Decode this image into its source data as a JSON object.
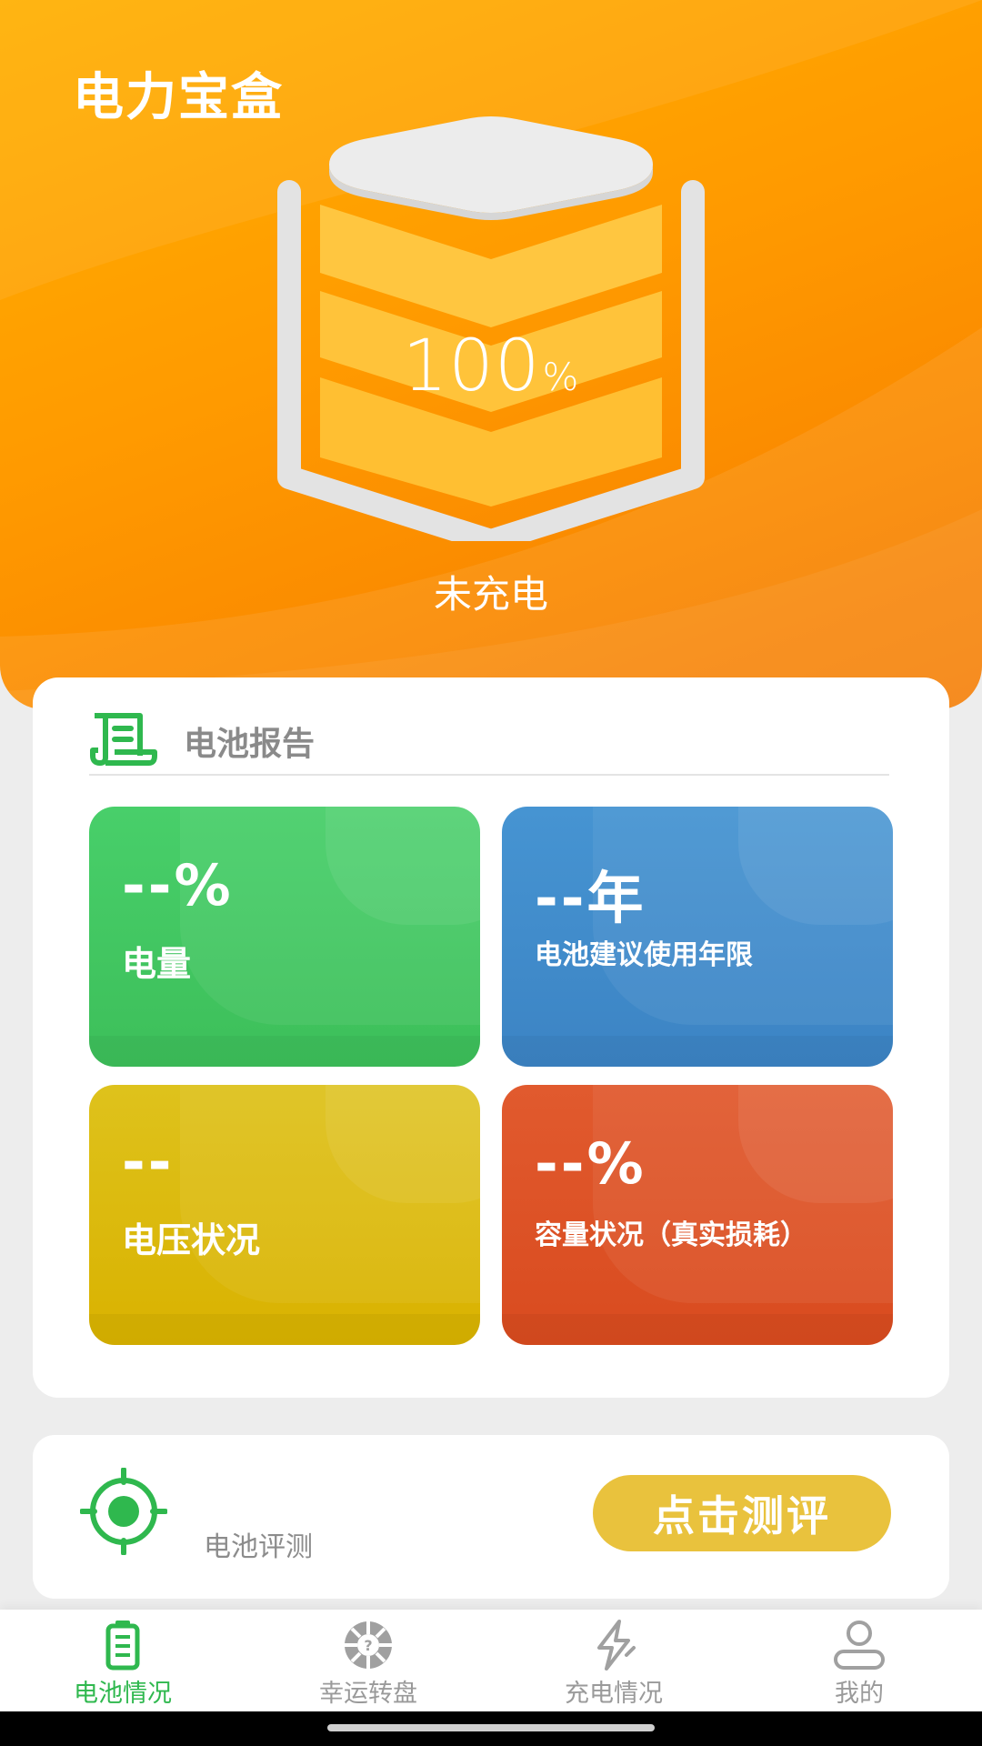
{
  "header": {
    "title": "电力宝盒",
    "battery_level": 100,
    "battery_value": "100",
    "battery_unit": "%",
    "charge_status": "未充电"
  },
  "report": {
    "title": "电池报告",
    "tiles": [
      {
        "value": "--%",
        "label": "电量",
        "color": "#44c964"
      },
      {
        "value": "--年",
        "label": "电池建议使用年限",
        "color": "#418dcc"
      },
      {
        "value": "--",
        "label": "电压状况",
        "color": "#dbb90f"
      },
      {
        "value": "--%",
        "label": "容量状况（真实损耗）",
        "color": "#dc5226"
      }
    ]
  },
  "evaluate": {
    "label": "电池评测",
    "button_label": "点击测评",
    "button_color": "#e9c23d"
  },
  "nav": {
    "items": [
      {
        "label": "电池情况",
        "icon": "battery-icon",
        "active": true
      },
      {
        "label": "幸运转盘",
        "icon": "lucky-wheel-icon",
        "active": false
      },
      {
        "label": "充电情况",
        "icon": "lightning-icon",
        "active": false
      },
      {
        "label": "我的",
        "icon": "user-icon",
        "active": false
      }
    ],
    "active_color": "#2fb84e"
  }
}
